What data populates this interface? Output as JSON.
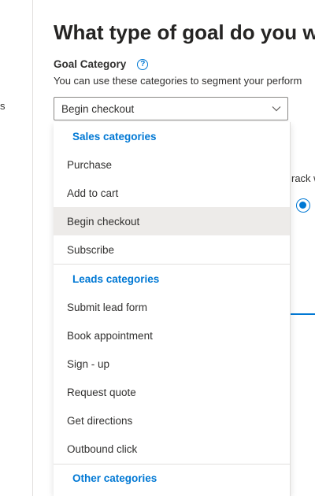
{
  "left_nav": {
    "fragment_text": "s"
  },
  "header": {
    "title": "What type of goal do you wa"
  },
  "goal_category": {
    "label": "Goal Category",
    "help_icon": "question-circle-icon",
    "help_glyph": "?",
    "helper_text": "You can use these categories to segment your perform",
    "selected_value": "Begin checkout",
    "chevron_icon": "chevron-down-icon"
  },
  "background": {
    "fragment_text": "rack w",
    "radio_selected": true
  },
  "dropdown": {
    "groups": [
      {
        "header": "Sales categories",
        "items": [
          "Purchase",
          "Add to cart",
          "Begin checkout",
          "Subscribe"
        ]
      },
      {
        "header": "Leads categories",
        "items": [
          "Submit lead form",
          "Book appointment",
          "Sign - up",
          "Request quote",
          "Get directions",
          "Outbound click"
        ]
      },
      {
        "header": "Other categories",
        "items": []
      }
    ],
    "selected_item": "Begin checkout"
  },
  "colors": {
    "accent": "#0078d4",
    "selected_bg": "#edebe9",
    "text": "#323130",
    "border": "#8a8886"
  }
}
